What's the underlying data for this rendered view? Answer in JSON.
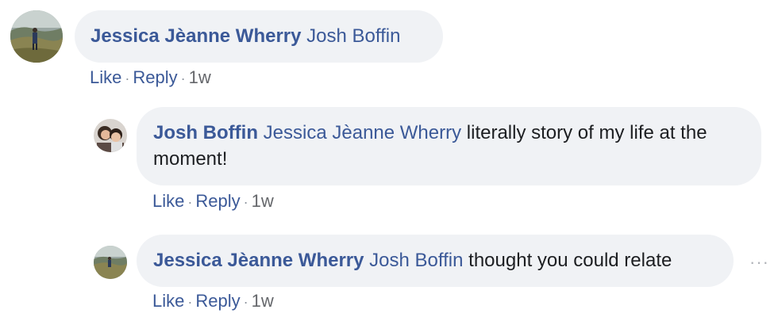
{
  "comments": [
    {
      "author": "Jessica Jèanne Wherry",
      "mention": "Josh Boffin",
      "text": "",
      "actions": {
        "like": "Like",
        "reply": "Reply",
        "time": "1w"
      }
    },
    {
      "author": "Josh Boffin",
      "mention": "Jessica Jèanne Wherry",
      "text": "literally story of my life at the moment!",
      "actions": {
        "like": "Like",
        "reply": "Reply",
        "time": "1w"
      }
    },
    {
      "author": "Jessica Jèanne Wherry",
      "mention": "Josh Boffin",
      "text": "thought you could relate",
      "actions": {
        "like": "Like",
        "reply": "Reply",
        "time": "1w"
      }
    }
  ],
  "separator": "·",
  "more_icon": "···",
  "colors": {
    "link": "#3b5998",
    "bubble": "#f0f2f5",
    "text": "#1c1e21",
    "meta": "#65676b"
  }
}
